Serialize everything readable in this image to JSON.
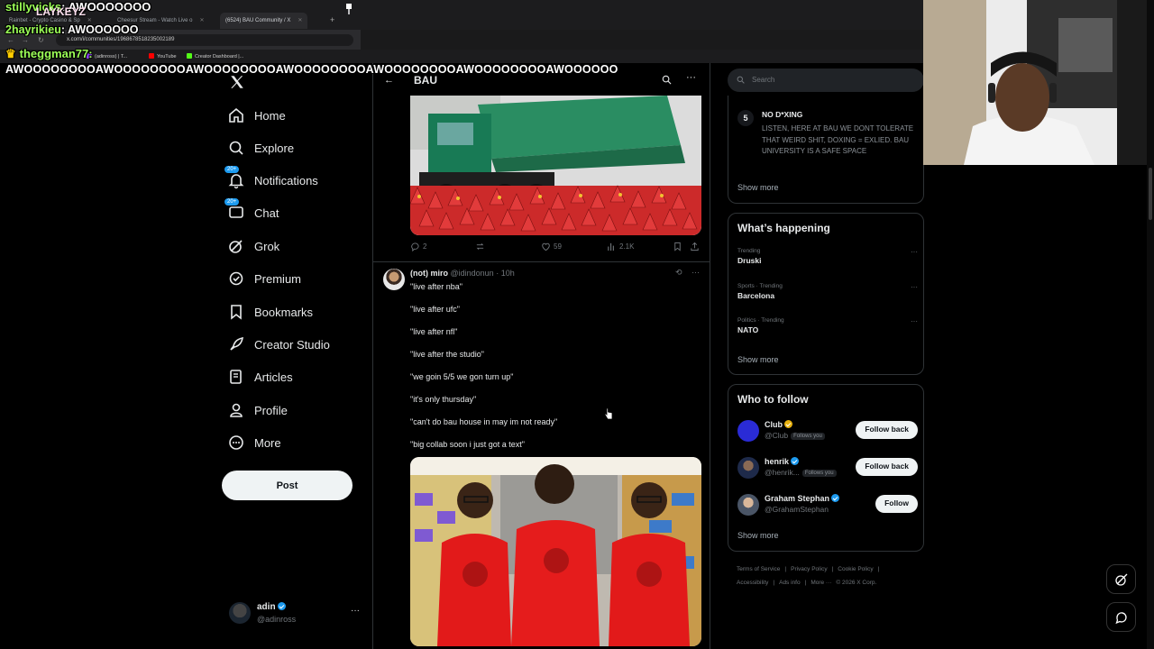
{
  "browser": {
    "tabs": [
      {
        "title": "Rainbet - Crypto Casino & Sp",
        "active": false
      },
      {
        "title": "Cheesur Stream - Watch Live o",
        "active": false
      },
      {
        "title": "(6524) BAU Community / X",
        "active": true
      }
    ],
    "url": "x.com/i/communities/1968678518235002189",
    "bookmarks": [
      {
        "label": "(adinross) | T...",
        "color": "#9146ff"
      },
      {
        "label": "YouTube",
        "color": "#ff0000"
      },
      {
        "label": "Creator Dashboard |...",
        "color": "#53fc18"
      }
    ]
  },
  "overlays": {
    "line1_name": "stillyvicks",
    "line1_text": "AWOOOOOOO",
    "banner": "LAYKEYZ",
    "line2_name": "2hayrikieu",
    "line2_text": "AWOOOOOO",
    "line3_name": "theggman77:",
    "awoo": "AWOOOOOOOOAWOOOOOOOOAWOOOOOOOOAWOOOOOOOOAWOOOOOOOOAWOOOOOOOOAWOOOOOO"
  },
  "nav": {
    "items": [
      {
        "label": "Home",
        "icon": "home-icon"
      },
      {
        "label": "Explore",
        "icon": "search-icon"
      },
      {
        "label": "Notifications",
        "icon": "bell-icon",
        "badge": "20+"
      },
      {
        "label": "Chat",
        "icon": "chat-icon",
        "badge": "20+"
      },
      {
        "label": "Grok",
        "icon": "grok-icon"
      },
      {
        "label": "Premium",
        "icon": "premium-icon"
      },
      {
        "label": "Bookmarks",
        "icon": "bookmark-icon"
      },
      {
        "label": "Creator Studio",
        "icon": "rocket-icon"
      },
      {
        "label": "Articles",
        "icon": "article-icon"
      },
      {
        "label": "Profile",
        "icon": "person-icon"
      },
      {
        "label": "More",
        "icon": "more-circle-icon"
      }
    ],
    "post": "Post",
    "me": {
      "name": "adin",
      "handle": "@adinross"
    }
  },
  "feed": {
    "title": "BAU",
    "post1_stats": {
      "replies": "2",
      "likes": "59",
      "views": "2.1K"
    },
    "tweet": {
      "name": "(not) miro",
      "handle": "@idindonun",
      "time": "· 10h",
      "lines": [
        "\"live after nba\"",
        "\"live after ufc\"",
        "\"live after nfl\"",
        "\"live after the studio\"",
        "\"we goin 5/5 we gon turn up\"",
        "\"it's only thursday\"",
        "\"can't do bau house in may im not ready\"",
        "\"big collab soon i just got a text\""
      ]
    }
  },
  "right": {
    "search_placeholder": "Search",
    "rule": {
      "num": "5",
      "title": "NO D*XING",
      "body": "LISTEN, HERE AT BAU WE DONT TOLERATE THAT WEIRD SHIT, DOXING = EXLIED. BAU UNIVERSITY IS A SAFE SPACE"
    },
    "show_more": "Show more",
    "happening_title": "What’s happening",
    "trends": [
      {
        "context": "Trending",
        "name": "Druski"
      },
      {
        "context": "Sports · Trending",
        "name": "Barcelona"
      },
      {
        "context": "Politics · Trending",
        "name": "NATO"
      }
    ],
    "follow_title": "Who to follow",
    "follows": [
      {
        "name": "Club",
        "handle": "@Club",
        "follows_you": "Follows you",
        "button": "Follow back",
        "avatar_color": "#2a2bd6",
        "badge": "gold"
      },
      {
        "name": "henrik",
        "handle": "@henrik...",
        "follows_you": "Follows you",
        "button": "Follow back",
        "avatar_color": "#1e2a4a",
        "badge": "blue"
      },
      {
        "name": "Graham Stephan",
        "handle": "@GrahamStephan",
        "follows_you": "",
        "button": "Follow",
        "avatar_color": "#4a5566",
        "badge": "blue"
      }
    ],
    "footer": [
      "Terms of Service",
      "|",
      "Privacy Policy",
      "|",
      "Cookie Policy",
      "|",
      "Accessibility",
      "|",
      "Ads info",
      "|",
      "More ···",
      "© 2026 X Corp."
    ]
  }
}
